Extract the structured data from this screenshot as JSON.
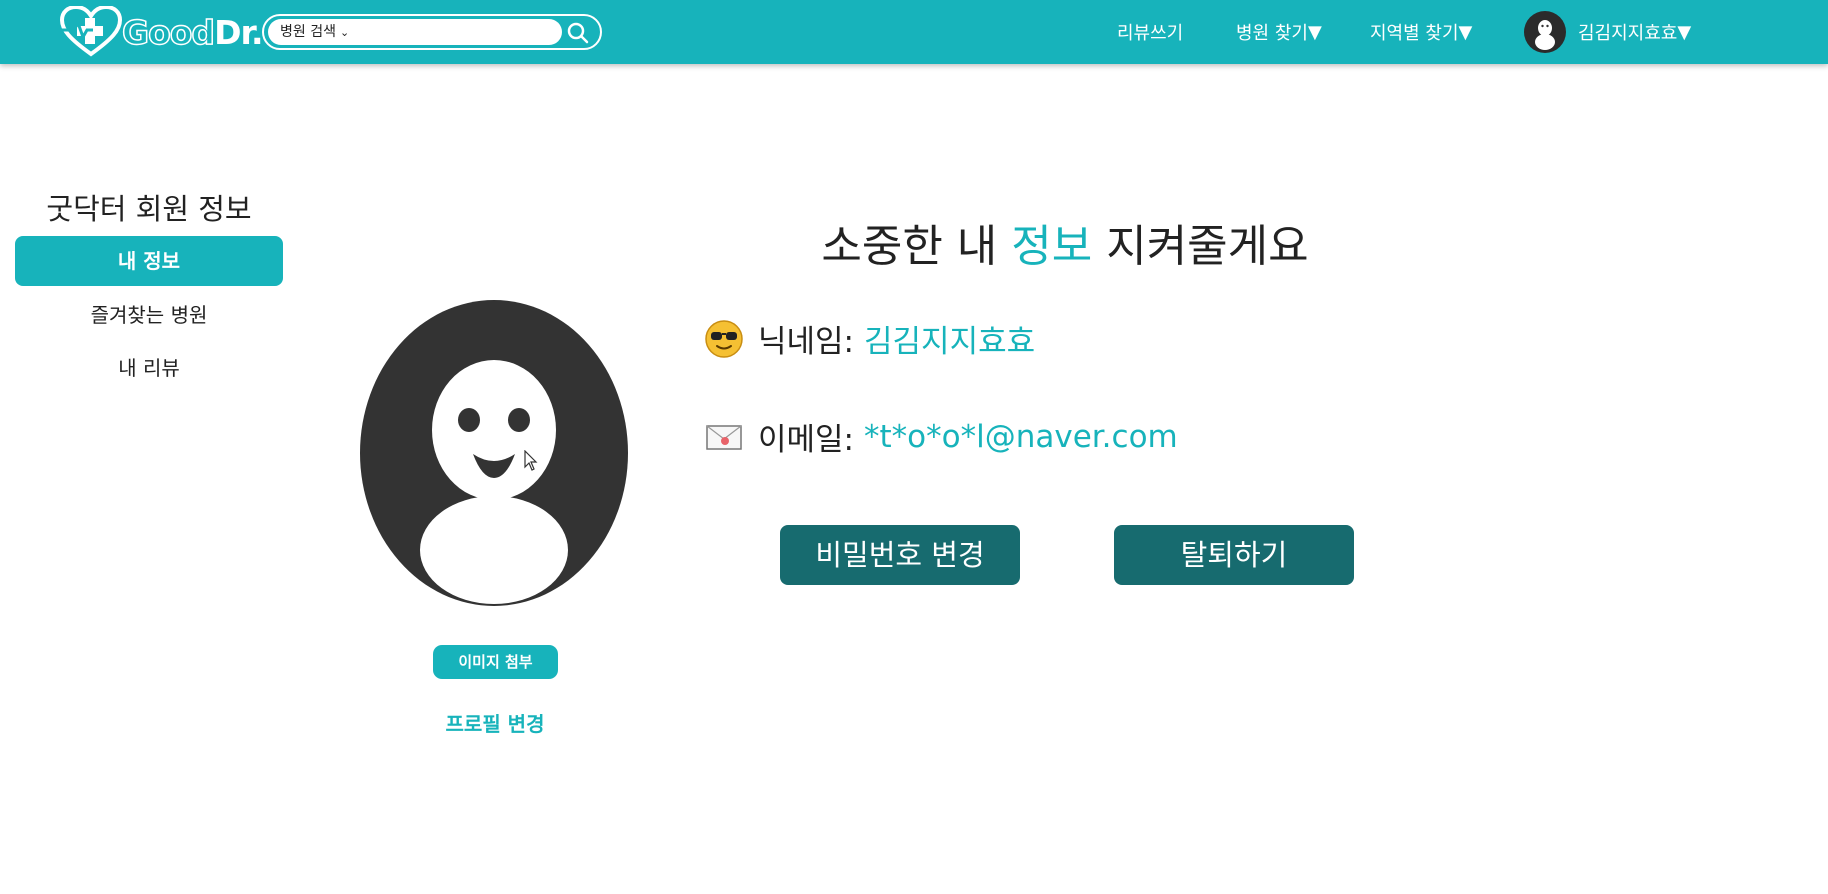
{
  "header": {
    "logo_text_good": "Good",
    "logo_text_dr": "Dr.",
    "search": {
      "selected_option": "병원 검색"
    },
    "nav": {
      "write_review": "리뷰쓰기",
      "find_hospital": "병원 찾기",
      "find_by_region": "지역별 찾기",
      "user_name": "김김지지효효"
    }
  },
  "sidebar": {
    "title": "굿닥터 회원 정보",
    "items": [
      {
        "label": "내 정보",
        "active": true
      },
      {
        "label": "즐겨찾는 병원",
        "active": false
      },
      {
        "label": "내 리뷰",
        "active": false
      }
    ]
  },
  "main": {
    "headline_before": "소중한 내 ",
    "headline_highlight": "정보",
    "headline_after": " 지켜줄게요",
    "nickname_label": "닉네임:",
    "nickname_value": "김김지지효효",
    "email_label": "이메일:",
    "email_value": "*t*o*o*l@naver.com",
    "attach_image_label": "이미지 첨부",
    "profile_change_label": "프로필 변경",
    "change_password_label": "비밀번호 변경",
    "withdraw_label": "탈퇴하기"
  },
  "colors": {
    "brand": "#17b3bb",
    "button_dark": "#176b6f",
    "avatar_bg": "#333333"
  },
  "icons": [
    "heart-logo-icon",
    "chevron-down-icon",
    "search-icon",
    "caret-down-icon",
    "user-avatar-icon",
    "sunglasses-emoji-icon",
    "envelope-emoji-icon",
    "mouse-cursor-icon"
  ]
}
